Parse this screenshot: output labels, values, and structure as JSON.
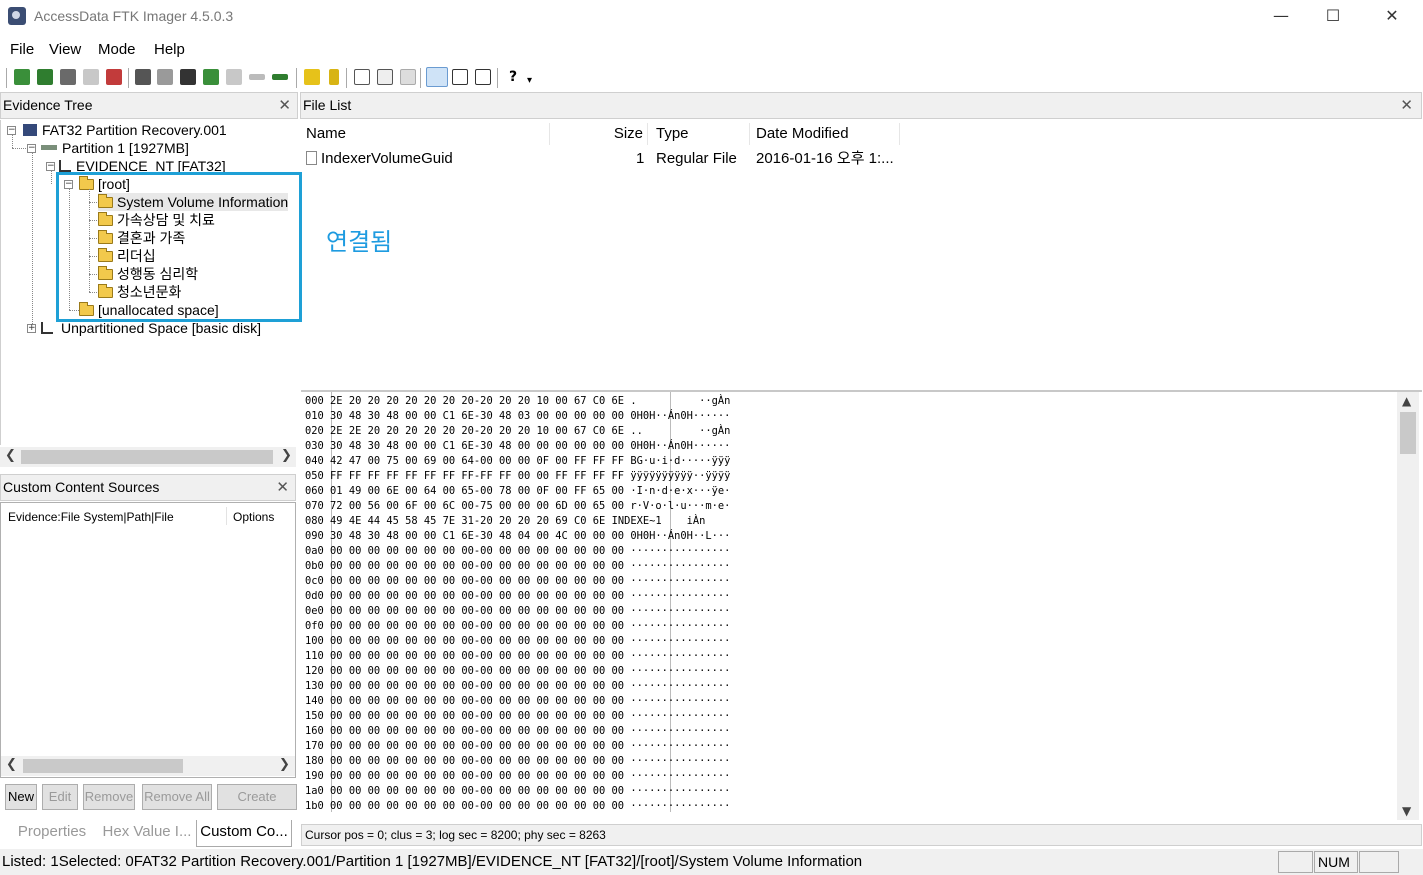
{
  "window": {
    "title": "AccessData FTK Imager 4.5.0.3",
    "minimize": "—",
    "maximize": "☐",
    "close": "✕"
  },
  "menu": [
    "File",
    "View",
    "Mode",
    "Help"
  ],
  "panes": {
    "evidence_tree": "Evidence Tree",
    "file_list": "File List",
    "custom_content": "Custom Content Sources",
    "close_glyph": "✕"
  },
  "tree": {
    "image": "FAT32 Partition Recovery.001",
    "partition": "Partition 1 [1927MB]",
    "volume": "EVIDENCE_NT [FAT32]",
    "root": "[root]",
    "folders": [
      "System Volume Information",
      "가속상담 및 치료",
      "결혼과 가족",
      "리더십",
      "성행동 심리학",
      "청소년문화"
    ],
    "unallocated": "[unallocated space]",
    "unpartitioned": "Unpartitioned Space [basic disk]"
  },
  "annotation": "연결됨",
  "file_list": {
    "columns": {
      "name": "Name",
      "size": "Size",
      "type": "Type",
      "date": "Date Modified"
    },
    "rows": [
      {
        "name": "IndexerVolumeGuid",
        "size": "1",
        "type": "Regular File",
        "date": "2016-01-16 오후 1:..."
      }
    ]
  },
  "custom_content": {
    "col1": "Evidence:File System|Path|File",
    "col2": "Options",
    "buttons": [
      "New",
      "Edit",
      "Remove",
      "Remove All",
      "Create Image"
    ]
  },
  "bottom_tabs": [
    "Properties",
    "Hex Value I...",
    "Custom Co..."
  ],
  "hex": {
    "rows": [
      {
        "off": "000",
        "hex": "2E 20 20 20 20 20 20 20-20 20 20 10 00 67 C0 6E",
        "asc": ".          ··gÀn"
      },
      {
        "off": "010",
        "hex": "30 48 30 48 00 00 C1 6E-30 48 03 00 00 00 00 00",
        "asc": "0H0H··Án0H······"
      },
      {
        "off": "020",
        "hex": "2E 2E 20 20 20 20 20 20-20 20 20 10 00 67 C0 6E",
        "asc": "..         ··gÀn"
      },
      {
        "off": "030",
        "hex": "30 48 30 48 00 00 C1 6E-30 48 00 00 00 00 00 00",
        "asc": "0H0H··Án0H······"
      },
      {
        "off": "040",
        "hex": "42 47 00 75 00 69 00 64-00 00 00 0F 00 FF FF FF",
        "asc": "BG·u·i·d·····ÿÿÿ"
      },
      {
        "off": "050",
        "hex": "FF FF FF FF FF FF FF FF-FF FF 00 00 FF FF FF FF",
        "asc": "ÿÿÿÿÿÿÿÿÿÿ··ÿÿÿÿ"
      },
      {
        "off": "060",
        "hex": "01 49 00 6E 00 64 00 65-00 78 00 0F 00 FF 65 00",
        "asc": "·I·n·d·e·x···ÿe·"
      },
      {
        "off": "070",
        "hex": "72 00 56 00 6F 00 6C 00-75 00 00 00 6D 00 65 00",
        "asc": "r·V·o·l·u···m·e·"
      },
      {
        "off": "080",
        "hex": "49 4E 44 45 58 45 7E 31-20 20 20 20 69 C0 6E",
        "asc": "INDEXE~1    iÀn"
      },
      {
        "off": "090",
        "hex": "30 48 30 48 00 00 C1 6E-30 48 04 00 4C 00 00 00",
        "asc": "0H0H··Án0H··L···"
      },
      {
        "off": "0a0",
        "hex": "00 00 00 00 00 00 00 00-00 00 00 00 00 00 00 00",
        "asc": "················"
      },
      {
        "off": "0b0",
        "hex": "00 00 00 00 00 00 00 00-00 00 00 00 00 00 00 00",
        "asc": "················"
      },
      {
        "off": "0c0",
        "hex": "00 00 00 00 00 00 00 00-00 00 00 00 00 00 00 00",
        "asc": "················"
      },
      {
        "off": "0d0",
        "hex": "00 00 00 00 00 00 00 00-00 00 00 00 00 00 00 00",
        "asc": "················"
      },
      {
        "off": "0e0",
        "hex": "00 00 00 00 00 00 00 00-00 00 00 00 00 00 00 00",
        "asc": "················"
      },
      {
        "off": "0f0",
        "hex": "00 00 00 00 00 00 00 00-00 00 00 00 00 00 00 00",
        "asc": "················"
      },
      {
        "off": "100",
        "hex": "00 00 00 00 00 00 00 00-00 00 00 00 00 00 00 00",
        "asc": "················"
      },
      {
        "off": "110",
        "hex": "00 00 00 00 00 00 00 00-00 00 00 00 00 00 00 00",
        "asc": "················"
      },
      {
        "off": "120",
        "hex": "00 00 00 00 00 00 00 00-00 00 00 00 00 00 00 00",
        "asc": "················"
      },
      {
        "off": "130",
        "hex": "00 00 00 00 00 00 00 00-00 00 00 00 00 00 00 00",
        "asc": "················"
      },
      {
        "off": "140",
        "hex": "00 00 00 00 00 00 00 00-00 00 00 00 00 00 00 00",
        "asc": "················"
      },
      {
        "off": "150",
        "hex": "00 00 00 00 00 00 00 00-00 00 00 00 00 00 00 00",
        "asc": "················"
      },
      {
        "off": "160",
        "hex": "00 00 00 00 00 00 00 00-00 00 00 00 00 00 00 00",
        "asc": "················"
      },
      {
        "off": "170",
        "hex": "00 00 00 00 00 00 00 00-00 00 00 00 00 00 00 00",
        "asc": "················"
      },
      {
        "off": "180",
        "hex": "00 00 00 00 00 00 00 00-00 00 00 00 00 00 00 00",
        "asc": "················"
      },
      {
        "off": "190",
        "hex": "00 00 00 00 00 00 00 00-00 00 00 00 00 00 00 00",
        "asc": "················"
      },
      {
        "off": "1a0",
        "hex": "00 00 00 00 00 00 00 00-00 00 00 00 00 00 00 00",
        "asc": "················"
      },
      {
        "off": "1b0",
        "hex": "00 00 00 00 00 00 00 00-00 00 00 00 00 00 00 00",
        "asc": "················"
      }
    ]
  },
  "cursor_status": "Cursor pos = 0; clus = 3; log sec = 8200; phy sec = 8263",
  "status": {
    "text": "Listed: 1Selected: 0FAT32 Partition Recovery.001/Partition 1 [1927MB]/EVIDENCE_NT [FAT32]/[root]/System Volume Information",
    "num": "NUM"
  },
  "colors": {
    "highlight": "#1ea0d6",
    "annotation": "#1e9be0"
  }
}
